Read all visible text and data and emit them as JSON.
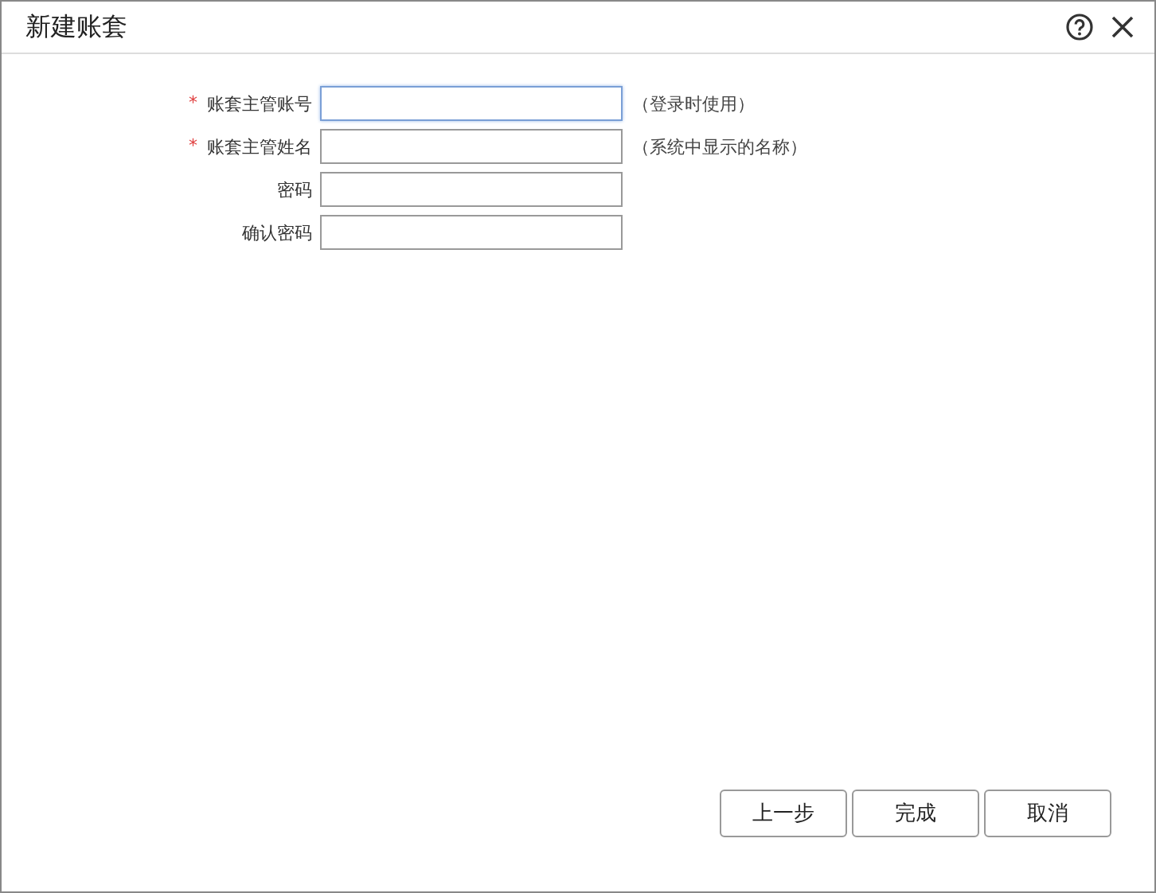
{
  "window": {
    "title": "新建账套"
  },
  "fields": [
    {
      "marker": "*",
      "label": "账套主管账号",
      "hint": "（登录时使用）",
      "focused": true
    },
    {
      "marker": "*",
      "label": "账套主管姓名",
      "hint": "（系统中显示的名称）",
      "focused": false
    },
    {
      "label": "密码",
      "focused": false
    },
    {
      "label": "确认密码",
      "focused": false
    }
  ],
  "buttons": [
    "上一步",
    "完成",
    "取消"
  ]
}
